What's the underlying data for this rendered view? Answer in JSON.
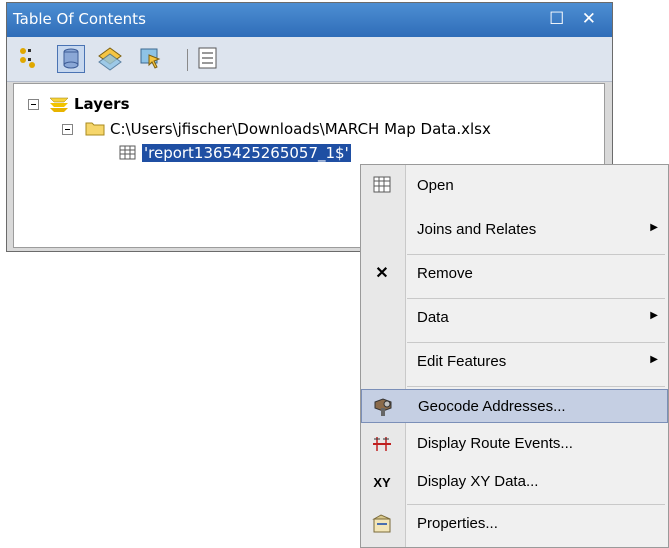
{
  "toc": {
    "title": "Table Of Contents",
    "title_buttons": "☐ ✕",
    "toolbar": [
      {
        "icon": "list-by-drawing-order-icon"
      },
      {
        "icon": "list-by-source-icon",
        "selected": true
      },
      {
        "icon": "list-by-visibility-icon"
      },
      {
        "icon": "list-by-selection-icon"
      },
      {
        "icon": "options-icon"
      }
    ],
    "tree": {
      "root_label": "Layers",
      "source_path": "C:\\Users\\jfischer\\Downloads\\MARCH Map Data.xlsx",
      "table_name": "'report1365425265057_1$'"
    }
  },
  "context_menu": {
    "items": [
      {
        "icon": "table-icon",
        "label": "Open"
      },
      {
        "icon": "",
        "label": "Joins and Relates",
        "submenu": true
      },
      {
        "icon": "remove-x-icon",
        "label": "Remove"
      },
      {
        "icon": "",
        "label": "Data",
        "submenu": true
      },
      {
        "icon": "",
        "label": "Edit Features",
        "submenu": true
      },
      {
        "icon": "geocode-icon",
        "label": "Geocode Addresses...",
        "highlighted": true
      },
      {
        "icon": "route-events-icon",
        "label": "Display Route Events..."
      },
      {
        "icon": "xy-data-icon",
        "label": "Display XY Data..."
      },
      {
        "icon": "properties-icon",
        "label": "Properties..."
      }
    ]
  }
}
